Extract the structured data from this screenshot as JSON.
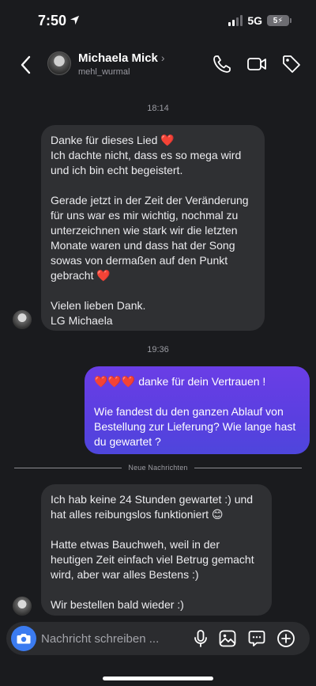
{
  "status": {
    "time": "7:50",
    "network": "5G",
    "battery": "5"
  },
  "header": {
    "contact_name": "Michaela Mick",
    "username": "mehl_wurmal",
    "icons": [
      "back-icon",
      "phone-icon",
      "video-icon",
      "tag-icon"
    ]
  },
  "conversation": {
    "time_1": "18:14",
    "msg_1": {
      "p1_text": "Danke für dieses Lied",
      "p1_heart": "❤️",
      "p1_rest": "Ich dachte nicht, dass es so mega wird und ich bin echt begeistert.",
      "p2_text": "Gerade jetzt in der Zeit der Veränderung für uns war es mir wichtig, nochmal zu unterzeichnen wie stark wir die letzten Monate waren und dass hat der Song sowas von dermaßen auf den Punkt gebracht",
      "p2_heart": "❤️",
      "p3_line1": "Vielen lieben Dank.",
      "p3_line2": "LG Michaela"
    },
    "time_2": "19:36",
    "msg_2": {
      "hearts": "❤️❤️❤️",
      "p1_text": "danke für dein Vertrauen !",
      "p2_text": "Wie fandest du den ganzen Ablauf von Bestellung zur Lieferung? Wie lange hast du gewartet ?"
    },
    "new_messages_label": "Neue Nachrichten",
    "msg_3": {
      "p1_text": "Ich hab keine 24 Stunden gewartet :) und hat alles reibungslos funktioniert",
      "p1_emoji": "😊",
      "p2_text": "Hatte etwas Bauchweh, weil in der heutigen Zeit einfach viel Betrug gemacht wird, aber war alles Bestens :)",
      "p3_text": "Wir bestellen bald wieder :)"
    }
  },
  "composer": {
    "placeholder": "Nachricht schreiben ...",
    "icons": [
      "camera-icon",
      "microphone-icon",
      "gallery-icon",
      "sticker-icon",
      "plus-icon"
    ]
  },
  "colors": {
    "background": "#1a1b1e",
    "incoming_bubble": "#2f3033",
    "outgoing_bubble_start": "#6a3ee6",
    "outgoing_bubble_end": "#4e46dc",
    "camera_button": "#3b7bf0",
    "heart": "#e8202e"
  }
}
